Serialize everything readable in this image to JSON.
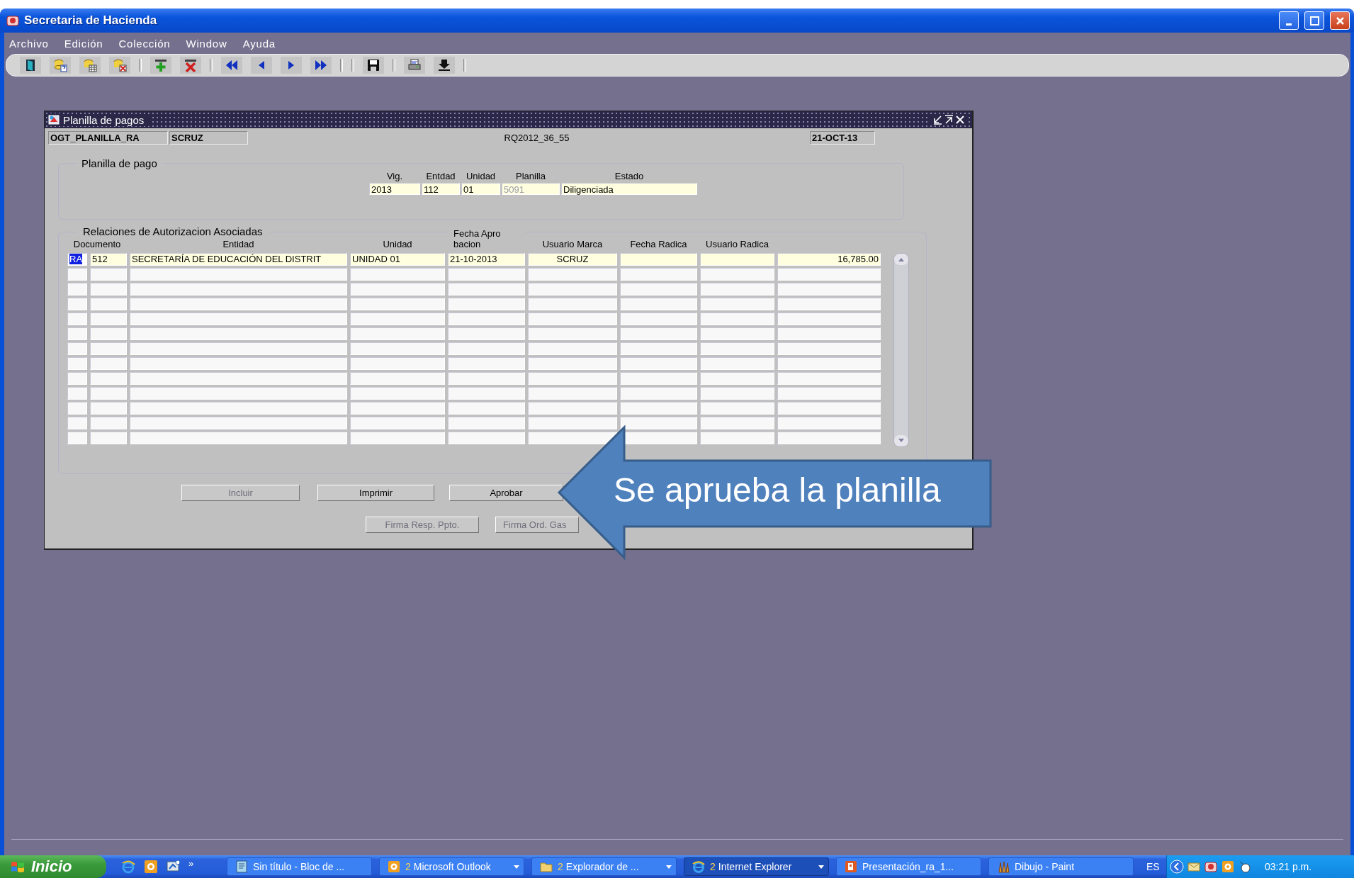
{
  "window": {
    "title": "Secretaria de Hacienda"
  },
  "menu": [
    {
      "label": "Archivo"
    },
    {
      "label": "Edición"
    },
    {
      "label": "Colección"
    },
    {
      "label": "Window"
    },
    {
      "label": "Ayuda"
    }
  ],
  "form": {
    "title": "Planilla de pagos",
    "header": {
      "module": "OGT_PLANILLA_RA",
      "user": "SCRUZ",
      "code": "RQ2012_36_55",
      "date": "21-OCT-13"
    },
    "planilla": {
      "title": "Planilla de pago",
      "fields": [
        {
          "label": "Vig.",
          "value": "2013",
          "disabled": false
        },
        {
          "label": "Entdad",
          "value": "112",
          "disabled": false
        },
        {
          "label": "Unidad",
          "value": "01",
          "disabled": false
        },
        {
          "label": "Planilla",
          "value": "5091",
          "disabled": true
        },
        {
          "label": "Estado",
          "value": "Diligenciada",
          "disabled": false
        }
      ]
    },
    "relaciones": {
      "title": "Relaciones de Autorizacion Asociadas",
      "columns": [
        {
          "lines": [
            "Documento"
          ]
        },
        {
          "kind": "blank"
        },
        {
          "lines": [
            "Entidad"
          ]
        },
        {
          "lines": [
            "Unidad"
          ]
        },
        {
          "lines": [
            "Fecha Apro",
            "bacion"
          ]
        },
        {
          "lines": [
            "Usuario Marca"
          ]
        },
        {
          "lines": [
            "Fecha Radica"
          ]
        },
        {
          "lines": [
            "Usuario Radica"
          ]
        }
      ],
      "rows": [
        {
          "cells": [
            {
              "text": "RA",
              "selected": true
            },
            {
              "text": "512",
              "selected": false
            },
            {
              "text": "SECRETARÍA DE EDUCACIÓN DEL DISTRIT",
              "selected": false
            },
            {
              "text": "UNIDAD 01",
              "selected": false
            },
            {
              "text": "21-10-2013",
              "selected": false
            },
            {
              "text": "SCRUZ",
              "selected": false
            },
            {
              "text": "",
              "selected": false
            },
            {
              "text": "",
              "selected": false
            },
            {
              "text": "16,785.00",
              "selected": false
            }
          ]
        }
      ]
    },
    "buttons": [
      {
        "label": "Incluir",
        "disabled": true
      },
      {
        "label": "Imprimir",
        "disabled": false
      },
      {
        "label": "Aprobar",
        "disabled": false
      }
    ],
    "buttons_2": [
      {
        "label": "Firma Resp. Ppto.",
        "disabled": true
      },
      {
        "label": "Firma Ord. Gas",
        "disabled": true
      }
    ]
  },
  "callout": {
    "text": "Se aprueba la planilla"
  },
  "taskbar": {
    "start": "Inicio",
    "more": "»",
    "tasks": [
      {
        "kind": "notepad",
        "label": "Sin título - Bloc de ...",
        "selected": false,
        "grouped": false
      },
      {
        "kind": "outlook",
        "count": "2",
        "label": "Microsoft Outlook",
        "selected": false,
        "grouped": true
      },
      {
        "kind": "folder",
        "count": "2",
        "label": "Explorador de ...",
        "selected": false,
        "grouped": true
      },
      {
        "kind": "ie",
        "count": "2",
        "label": "Internet Explorer",
        "selected": true,
        "grouped": true
      },
      {
        "kind": "powerpoint",
        "label": "Presentación_ra_1...",
        "selected": false,
        "grouped": false
      },
      {
        "kind": "paint",
        "label": "Dibujo - Paint",
        "selected": false,
        "grouped": false
      }
    ],
    "language": "ES",
    "clock": "03:21 p.m."
  }
}
